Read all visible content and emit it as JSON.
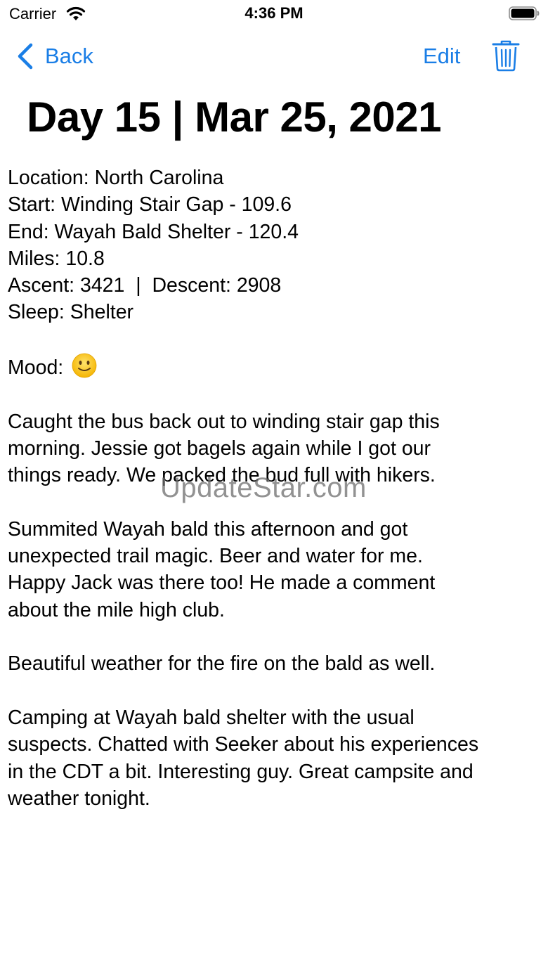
{
  "status_bar": {
    "carrier": "Carrier",
    "time": "4:36 PM"
  },
  "nav": {
    "back_label": "Back",
    "edit_label": "Edit",
    "accent_color": "#1a7ee6",
    "icons": [
      "chevron-left-icon",
      "trash-icon"
    ]
  },
  "title": "Day 15 | Mar 25, 2021",
  "entry": {
    "location": "Location: North Carolina",
    "start": "Start: Winding Stair Gap - 109.6",
    "end": "End: Wayah Bald Shelter - 120.4",
    "miles": "Miles: 10.8",
    "elevation": "Ascent: 3421  |  Descent: 2908",
    "sleep": "Sleep: Shelter",
    "mood_label": "Mood:",
    "mood_icon": "slightly-smiling-face-icon",
    "paragraphs": [
      [
        "Caught the bus back out to winding stair gap this",
        "morning. Jessie got bagels again while I got our",
        "things ready. We packed the bud full with hikers."
      ],
      [
        "Summited Wayah bald this afternoon and got",
        "unexpected trail magic. Beer and water for me.",
        "Happy Jack was there too! He made a comment",
        "about the mile high club."
      ],
      [
        "Beautiful weather for the fire on the bald as well."
      ],
      [
        "Camping at Wayah bald shelter with the usual",
        "suspects. Chatted with Seeker about his experiences",
        "in the CDT a bit. Interesting guy. Great campsite and",
        "weather tonight."
      ]
    ]
  },
  "watermark": "UpdateStar.com"
}
